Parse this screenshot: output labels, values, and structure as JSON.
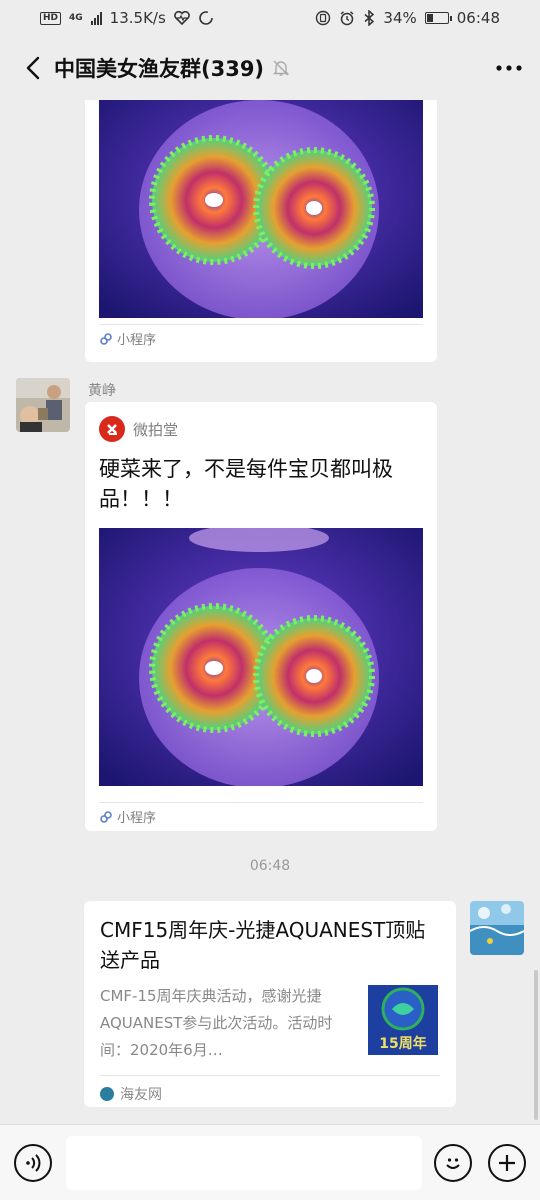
{
  "status_bar": {
    "hd": "HD",
    "network": "4G",
    "speed": "13.5K/s",
    "battery": "34%",
    "time": "06:48"
  },
  "header": {
    "title": "中国美女渔友群(339)"
  },
  "messages": [
    {
      "type": "miniprogram",
      "partial": true,
      "footer_label": "小程序"
    },
    {
      "type": "miniprogram",
      "sender": "黄峥",
      "app_name": "微拍堂",
      "text": "硬菜来了，不是每件宝贝都叫极品！！！",
      "footer_label": "小程序"
    },
    {
      "type": "timestamp",
      "text": "06:48"
    },
    {
      "type": "article",
      "self": true,
      "title": "CMF15周年庆-光捷AQUANEST顶贴送产品",
      "description": "CMF-15周年庆典活动，感谢光捷AQUANEST参与此次活动。活动时间：2020年6月…",
      "thumbnail_text": "15周年",
      "source": "海友网"
    }
  ],
  "colors": {
    "background": "#ededed",
    "card": "#ffffff",
    "app_icon": "#d9281c",
    "coral_bg": "#2a1f8f"
  }
}
